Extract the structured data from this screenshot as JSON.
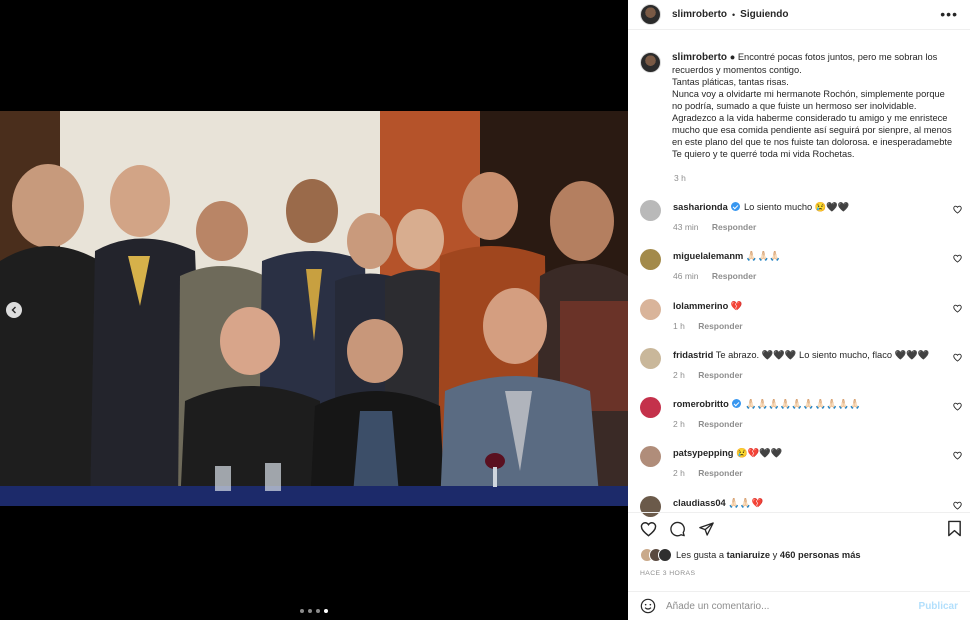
{
  "post": {
    "username": "slimroberto",
    "separator": "•",
    "follow_status": "Siguiendo",
    "more_icon": "more-options-icon",
    "photo_alt": "",
    "carousel": {
      "count": 4,
      "active_index": 3
    }
  },
  "caption": {
    "username": "slimroberto",
    "lines": [
      "Encontré pocas fotos juntos, pero me sobran los",
      "recuerdos y momentos contigo.",
      "Tantas pláticas, tantas risas.",
      "Nunca voy a olvidarte mi hermanote Rochón, simplemente porque",
      "no podría, sumado a que fuiste un hermoso ser inolvidable.",
      "Agradezco a la vida haberme considerado tu amigo y me enristece",
      "mucho que esa comida pendiente así seguirá por sienpre, al menos",
      "en este plano del que te nos fuiste tan dolorosa. e inesperadamebte",
      "Te quiero y te querré toda mi vida Rochetas."
    ],
    "prefix_symbol": "●",
    "time": "3 h"
  },
  "comments": [
    {
      "user": "sasharionda",
      "verified": true,
      "text": "Lo siento mucho 😢🖤🖤",
      "time": "43 min",
      "reply": "Responder",
      "avatar_color": "#b9b9b9"
    },
    {
      "user": "miguelalemanm",
      "verified": false,
      "text": "🙏🏻🙏🏻🙏🏻",
      "time": "46 min",
      "reply": "Responder",
      "avatar_color": "#a38a4a"
    },
    {
      "user": "lolammerino",
      "verified": false,
      "text": "💔",
      "time": "1 h",
      "reply": "Responder",
      "avatar_color": "#d9b49a"
    },
    {
      "user": "fridastrid",
      "verified": false,
      "text": "Te abrazo. 🖤🖤🖤 Lo siento mucho, flaco 🖤🖤🖤",
      "time": "2 h",
      "reply": "Responder",
      "avatar_color": "#c9b79a"
    },
    {
      "user": "romerobritto",
      "verified": true,
      "text": "🙏🏻🙏🏻🙏🏻🙏🏻🙏🏻🙏🏻🙏🏻🙏🏻🙏🏻🙏🏻",
      "time": "2 h",
      "reply": "Responder",
      "avatar_color": "#c4314b"
    },
    {
      "user": "patsypepping",
      "verified": false,
      "text": "😢💔🖤🖤",
      "time": "2 h",
      "reply": "Responder",
      "avatar_color": "#b08d7a"
    },
    {
      "user": "claudiass04",
      "verified": false,
      "text": "🙏🏻🙏🏻💔",
      "time": "",
      "reply": "",
      "avatar_color": "#6b5a4a"
    }
  ],
  "likes": {
    "prefix": "Les gusta a",
    "user": "taniaruize",
    "middle": "y",
    "count_text": "460 personas más",
    "avatar_colors": [
      "#c9a98a",
      "#5a4a40",
      "#2f2f2f"
    ]
  },
  "posted_ago": "HACE 3 HORAS",
  "composer": {
    "placeholder": "Añade un comentario...",
    "publish_label": "Publicar"
  },
  "colors": {
    "accent_blue": "#3897f0",
    "publish_disabled": "#b2dffc",
    "meta_grey": "#8e8e8e",
    "text": "#262626"
  }
}
